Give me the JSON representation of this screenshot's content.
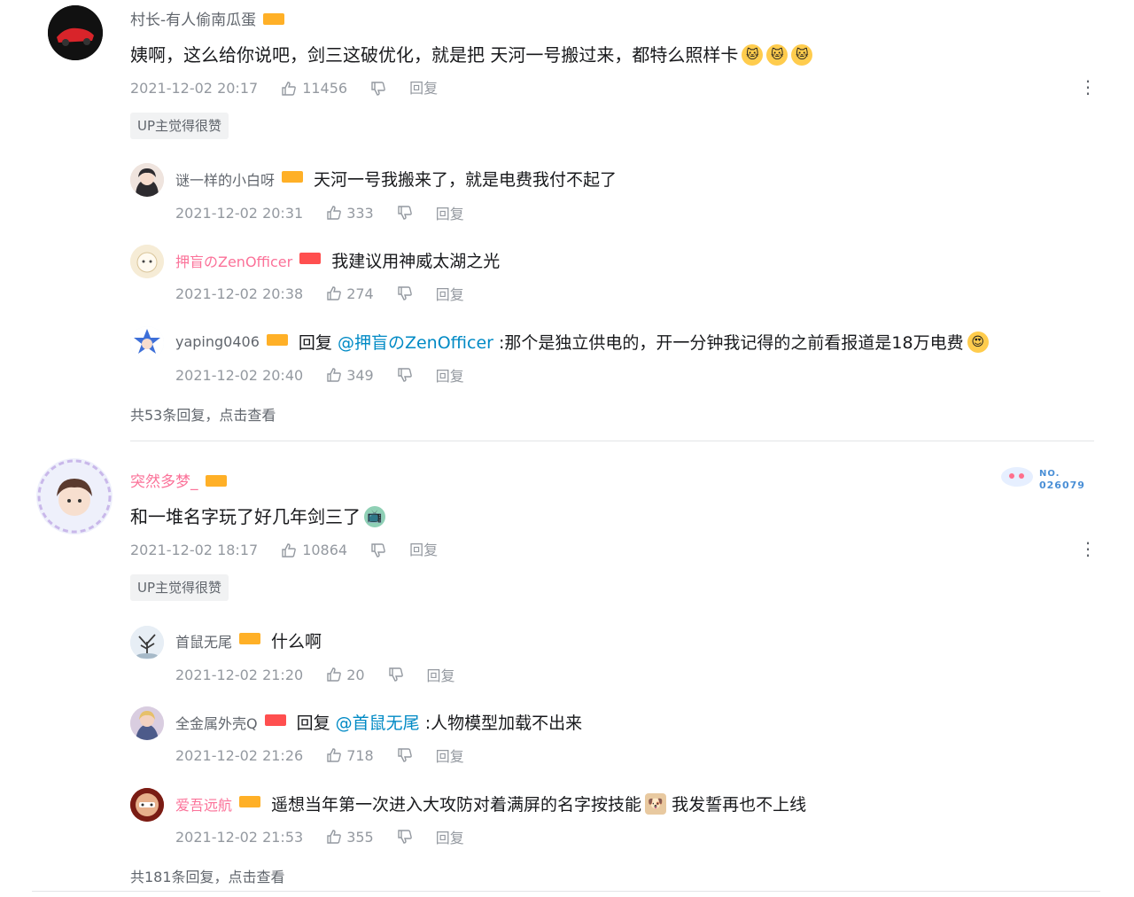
{
  "threads": [
    {
      "username": "村长-有人偷南瓜蛋",
      "text_a": "姨啊，这么给你说吧，剑三这破优化，就是把 天河一号搬过来，都特么照样卡",
      "time": "2021-12-02 20:17",
      "likes": "11456",
      "reply_label": "回复",
      "up_tag": "UP主觉得很赞",
      "replies": [
        {
          "name": "谜一样的小白呀",
          "text": "天河一号我搬来了，就是电费我付不起了",
          "time": "2021-12-02 20:31",
          "likes": "333",
          "reply_label": "回复"
        },
        {
          "name": "押盲のZenOfficer",
          "text": "我建议用神威太湖之光",
          "time": "2021-12-02 20:38",
          "likes": "274",
          "reply_label": "回复"
        },
        {
          "name": "yaping0406",
          "reply_prefix": "回复",
          "mention": "@押盲のZenOfficer",
          "text": ":那个是独立供电的，开一分钟我记得的之前看报道是18万电费",
          "time": "2021-12-02 20:40",
          "likes": "349",
          "reply_label": "回复"
        }
      ],
      "view_more": "共53条回复，点击查看"
    },
    {
      "username": "突然多梦_",
      "text_a": "和一堆名字玩了好几年剑三了",
      "time": "2021-12-02 18:17",
      "likes": "10864",
      "reply_label": "回复",
      "up_tag": "UP主觉得很赞",
      "badge_no": "NO.",
      "badge_num": "026079",
      "replies": [
        {
          "name": "首鼠无尾",
          "text": "什么啊",
          "time": "2021-12-02 21:20",
          "likes": "20",
          "reply_label": "回复"
        },
        {
          "name": "全金属外壳Q",
          "reply_prefix": "回复",
          "mention": "@首鼠无尾",
          "text": ":人物模型加载不出来",
          "time": "2021-12-02 21:26",
          "likes": "718",
          "reply_label": "回复"
        },
        {
          "name": "爱吾远航",
          "text_a": "遥想当年第一次进入大攻防对着满屏的名字按技能",
          "text_b": "我发誓再也不上线",
          "time": "2021-12-02 21:53",
          "likes": "355",
          "reply_label": "回复"
        }
      ],
      "view_more": "共181条回复，点击查看"
    }
  ],
  "colors": {
    "link": "#008ac5",
    "vip_pink": "#fb7299",
    "meta_gray": "#9499a0",
    "level_orange": "#ffb027",
    "level_red": "#ff4f4f"
  }
}
